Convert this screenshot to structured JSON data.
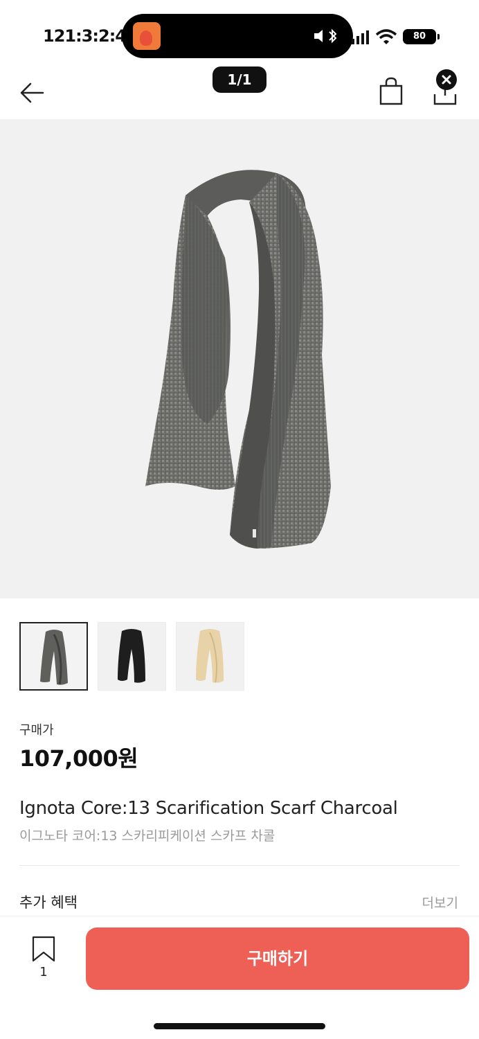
{
  "status_bar": {
    "time": "121:3:2:4:9",
    "battery": "80"
  },
  "nav": {
    "page_indicator": "1/1"
  },
  "product": {
    "image_alt_colors": {
      "charcoal": "#5a5b58",
      "black": "#1e1e1e",
      "beige": "#e8d2a8"
    },
    "thumbnails": [
      {
        "name": "charcoal",
        "selected": true
      },
      {
        "name": "black",
        "selected": false
      },
      {
        "name": "beige",
        "selected": false
      }
    ],
    "price_label": "구매가",
    "price": "107,000원",
    "name_en": "Ignota Core:13 Scarification Scarf Charcoal",
    "name_ko": "이그노타 코어:13 스카리피케이션 스카프 차콜"
  },
  "benefits": {
    "title": "추가 혜택",
    "more_label": "더보기"
  },
  "bottom": {
    "bookmark_count": "1",
    "buy_label": "구매하기",
    "buy_color": "#ee5f55"
  }
}
